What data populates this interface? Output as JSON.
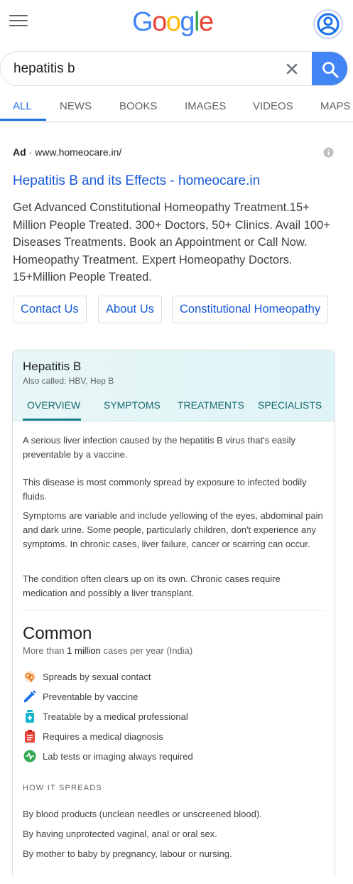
{
  "header": {
    "logo_letters": [
      "G",
      "o",
      "o",
      "g",
      "l",
      "e"
    ],
    "menu_icon": "hamburger-menu-icon",
    "account_icon": "account-circle-icon"
  },
  "search": {
    "query": "hepatitis b",
    "clear_icon": "close-icon",
    "search_icon": "magnifier-icon"
  },
  "tabs": [
    "ALL",
    "NEWS",
    "BOOKS",
    "IMAGES",
    "VIDEOS",
    "MAPS"
  ],
  "ad": {
    "badge": "Ad",
    "separator": "·",
    "display_url": "www.homeocare.in/",
    "title": "Hepatitis B and its Effects - homeocare.in",
    "description": "Get Advanced Constitutional Homeopathy Treatment.15+ Million People Treated. 300+ Doctors, 50+ Clinics. Avail 100+ Diseases Treatments. Book an Appointment or Call Now. Homeopathy Treatment. Expert Homeopathy Doctors. 15+Million People Treated.",
    "sitelinks": [
      "Contact Us",
      "About Us",
      "Constitutional Homeopathy"
    ]
  },
  "knowledge_panel": {
    "title": "Hepatitis B",
    "also_called": "Also called: HBV, Hep B",
    "tabs": [
      "OVERVIEW",
      "SYMPTOMS",
      "TREATMENTS",
      "SPECIALISTS"
    ],
    "paragraphs": [
      "A serious liver infection caused by the hepatitis B virus that's easily preventable by a vaccine.",
      "This disease is most commonly spread by exposure to infected bodily fluids.",
      "Symptoms are variable and include yellowing of the eyes, abdominal pain and dark urine. Some people, particularly children, don't experience any symptoms. In chronic cases, liver failure, cancer or scarring can occur.",
      "The condition often clears up on its own. Chronic cases require medication and possibly a liver transplant."
    ],
    "prevalence": {
      "heading": "Common",
      "prefix": "More than",
      "count": "1 million",
      "suffix": "cases per year (India)"
    },
    "facts": [
      {
        "icon": "sexual-contact-icon",
        "label": "Spreads by sexual contact",
        "color": "#e8710a"
      },
      {
        "icon": "syringe-icon",
        "label": "Preventable by vaccine",
        "color": "#1a73e8"
      },
      {
        "icon": "medicine-bottle-icon",
        "label": "Treatable by a medical professional",
        "color": "#12b5cb"
      },
      {
        "icon": "clipboard-icon",
        "label": "Requires a medical diagnosis",
        "color": "#e8453c"
      },
      {
        "icon": "lab-test-icon",
        "label": "Lab tests or imaging always required",
        "color": "#34a853"
      }
    ],
    "how_it_spreads_heading": "HOW IT SPREADS",
    "spreads": [
      "By blood products (unclean needles or unscreened blood).",
      "By having unprotected vaginal, anal or oral sex.",
      "By mother to baby by pregnancy, labour or nursing."
    ]
  }
}
